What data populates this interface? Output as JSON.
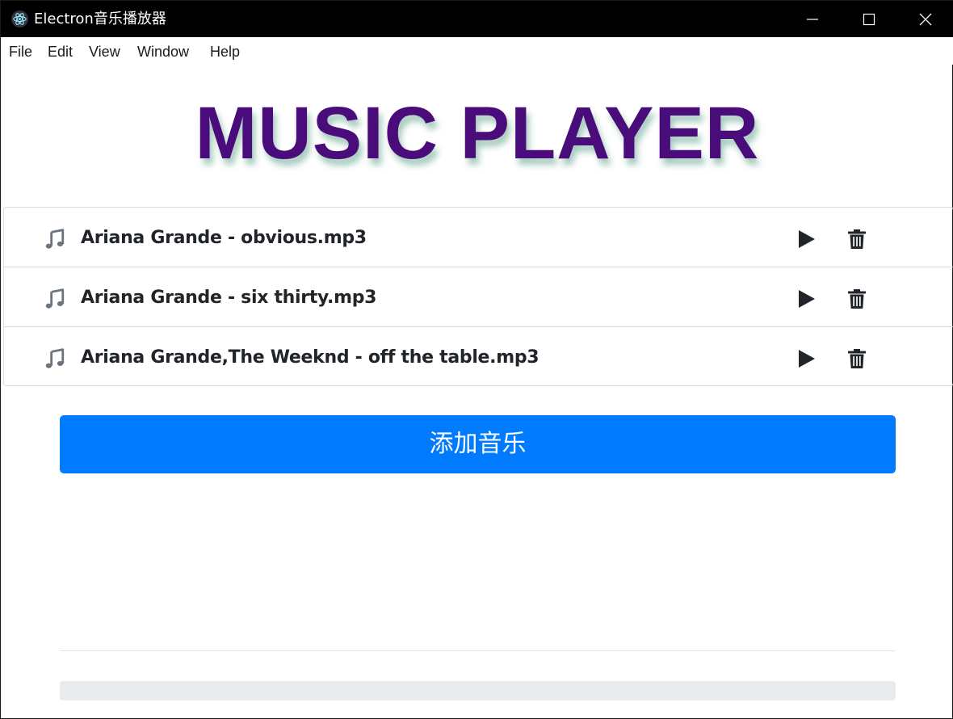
{
  "window": {
    "title": "Electron音乐播放器"
  },
  "menu": {
    "items": [
      "File",
      "Edit",
      "View",
      "Window",
      "Help"
    ]
  },
  "app": {
    "heading": "MUSIC PLAYER",
    "heading_color": "#4b0c7b",
    "accent_color": "#007bff"
  },
  "tracks": [
    {
      "name": "Ariana Grande - obvious.mp3",
      "icon": "music-note-icon"
    },
    {
      "name": "Ariana Grande - six thirty.mp3",
      "icon": "music-note-icon"
    },
    {
      "name": "Ariana Grande,The Weeknd - off the table.mp3",
      "icon": "music-note-icon"
    }
  ],
  "add_button": {
    "label": "添加音乐"
  },
  "player": {
    "progress": 0
  }
}
